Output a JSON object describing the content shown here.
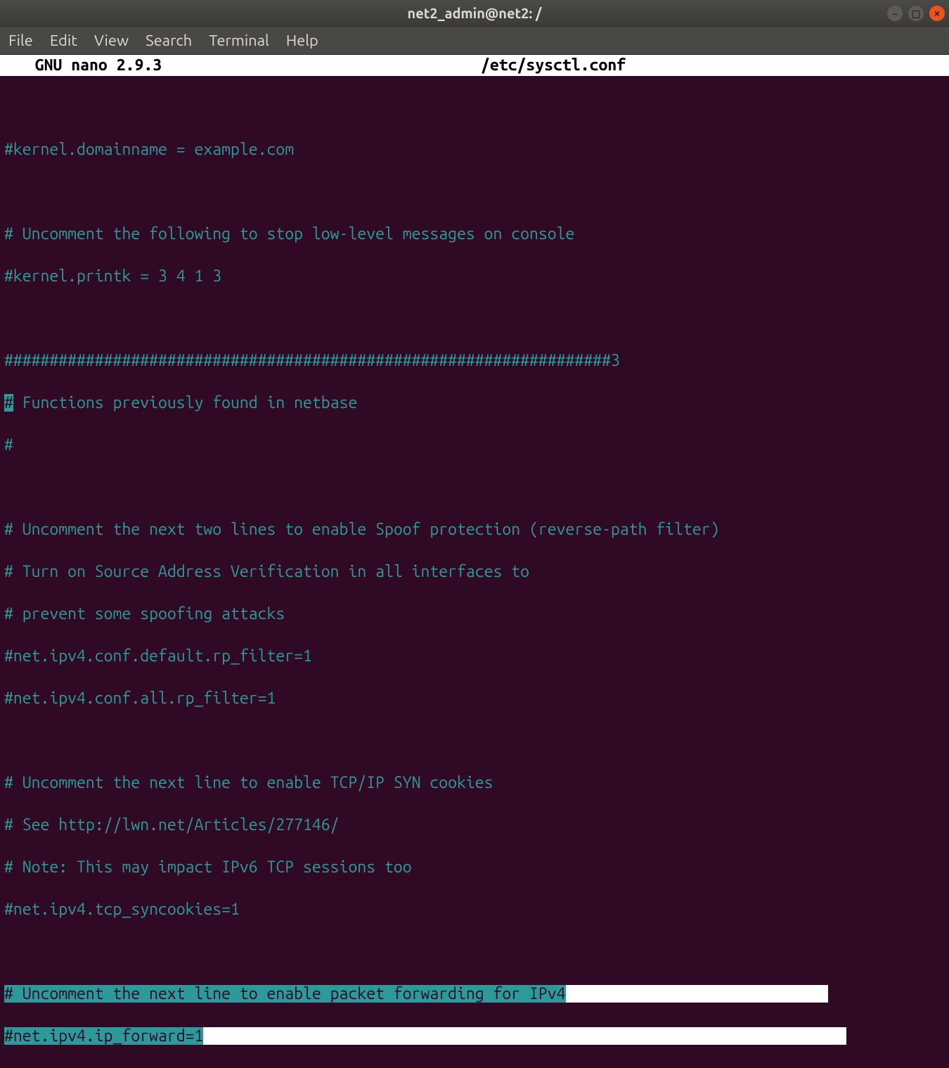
{
  "window": {
    "title": "net2_admin@net2: /"
  },
  "menu": {
    "file": "File",
    "edit": "Edit",
    "view": "View",
    "search": "Search",
    "terminal": "Terminal",
    "help": "Help"
  },
  "nano": {
    "app": "  GNU nano 2.9.3",
    "filename": "/etc/sysctl.conf"
  },
  "lines": {
    "l1": "",
    "l2": "#kernel.domainname = example.com",
    "l3": "",
    "l4": "# Uncomment the following to stop low-level messages on console",
    "l5": "#kernel.printk = 3 4 1 3",
    "l6": "",
    "l7": "###################################################################3",
    "l8a": "#",
    "l8b": " Functions previously found in netbase",
    "l9": "#",
    "l10": "",
    "l11": "# Uncomment the next two lines to enable Spoof protection (reverse-path filter)",
    "l12": "# Turn on Source Address Verification in all interfaces to",
    "l13": "# prevent some spoofing attacks",
    "l14": "#net.ipv4.conf.default.rp_filter=1",
    "l15": "#net.ipv4.conf.all.rp_filter=1",
    "l16": "",
    "l17": "# Uncomment the next line to enable TCP/IP SYN cookies",
    "l18": "# See http://lwn.net/Articles/277146/",
    "l19": "# Note: This may impact IPv6 TCP sessions too",
    "l20": "#net.ipv4.tcp_syncookies=1",
    "l21": "",
    "sel1": "# Uncomment the next line to enable packet forwarding for IPv4",
    "sel1_pad": "                             ",
    "sel2": "#net.ipv4.ip_forward=1",
    "sel2_pad": "                                                                       "
  }
}
